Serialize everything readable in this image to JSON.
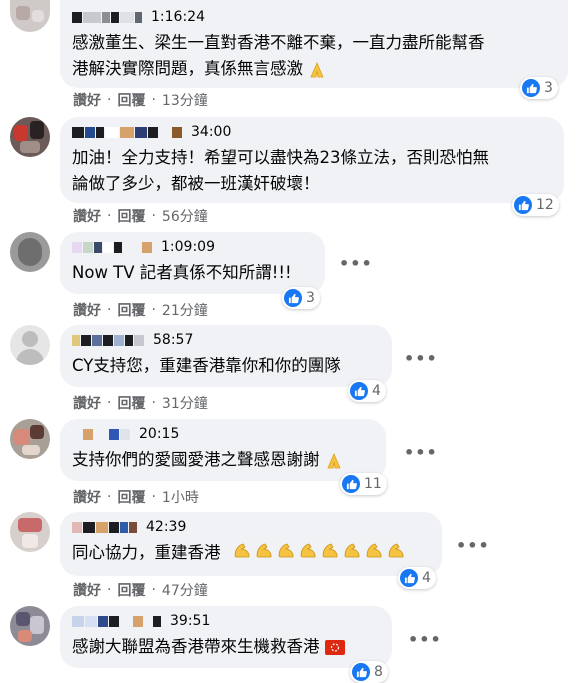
{
  "actions": {
    "like": "讚好",
    "reply": "回覆"
  },
  "comments": [
    {
      "timestamp": "1:16:24",
      "text_lines": [
        "感激董生、梁生一直對香港不離不棄，一直力盡所能幫香",
        "港解決實際問題，真係無言感激"
      ],
      "reactions": "3",
      "age": "13分鐘",
      "emoji": "folded-hands"
    },
    {
      "timestamp": "34:00",
      "text_lines": [
        "加油！全力支持！希望可以盡快為23條立法，否則恐怕無",
        "論做了多少，都被一班漢奸破壞！"
      ],
      "reactions": "12",
      "age": "56分鐘"
    },
    {
      "timestamp": "1:09:09",
      "text_lines": [
        "Now TV 記者真係不知所謂!!!"
      ],
      "reactions": "3",
      "age": "21分鐘"
    },
    {
      "timestamp": "58:57",
      "text_lines": [
        "CY支持您，重建香港靠你和你的團隊"
      ],
      "reactions": "4",
      "age": "31分鐘"
    },
    {
      "timestamp": "20:15",
      "text_lines": [
        "支持你們的愛國愛港之聲感恩謝謝"
      ],
      "reactions": "11",
      "age": "1小時",
      "emoji": "folded-hands"
    },
    {
      "timestamp": "42:39",
      "text_lines": [
        "同心協力，重建香港"
      ],
      "reactions": "4",
      "age": "47分鐘",
      "emoji": "flexed-biceps-x8"
    },
    {
      "timestamp": "39:51",
      "text_lines": [
        "感謝大聯盟為香港帶來生機救香港"
      ],
      "reactions": "8",
      "age": "",
      "emoji": "hong-kong-flag"
    }
  ],
  "colors": {
    "like_blue": "#1877f2",
    "bubble_bg": "#f0f2f5",
    "secondary_text": "#65676b"
  }
}
